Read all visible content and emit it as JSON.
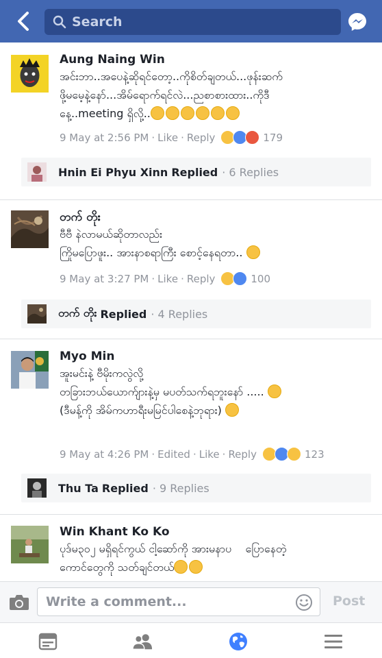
{
  "header": {
    "search_placeholder": "Search"
  },
  "comments": [
    {
      "author": "Aung Naing Win",
      "lines": [
        "အင်းဘာ..အပေနဲ့ဆိုရင်တော့..ကိုစိတ်ချတယ်...ဖုန်းဆက်",
        "ဖို့မမေ့နဲ့နော်...အိမ်ရောက်ရင်လဲ...ညစာစားထား..ကိုဒီ",
        "နေ့..meeting ရှိလို့.."
      ],
      "emoji_trail": [
        "grin",
        "grin",
        "joy",
        "joy",
        "joy",
        "joy"
      ],
      "time": "9 May at 2:56 PM",
      "edited": "",
      "like": "Like",
      "reply": "Reply",
      "reactions": [
        "haha",
        "like",
        "angry"
      ],
      "reaction_count": "179",
      "reply_preview": {
        "name": "Hnin Ei Phyu Xinn",
        "label": "Replied",
        "count": "6 Replies"
      }
    },
    {
      "author": "တက် တိုး",
      "lines": [
        "ဗီဗီ နဲလာမယ်ဆိုတာလည်း",
        "ကြိုမပြောဖူး.. အားနာစရာကြီး စောင့်နေရတာ.."
      ],
      "emoji_trail": [
        "joy"
      ],
      "time": "9 May at 3:27 PM",
      "edited": "",
      "like": "Like",
      "reply": "Reply",
      "reactions": [
        "haha",
        "like"
      ],
      "reaction_count": "100",
      "reply_preview": {
        "name": "တက် တိုး",
        "label": "Replied",
        "count": "4 Replies"
      }
    },
    {
      "author": "Myo Min",
      "lines": [
        "အူးမင်းနဲ့ ဗီမိုးကလွဲလို့",
        "တခြားဘယ်ယောက်ျားနဲ့မှ မပတ်သက်ရဘူးနော် .....",
        "",
        "(ဒီမန့်ကို အိမ်ကဟာရီးမမြင်ပါစေနဲ့ဘုရား)"
      ],
      "emoji_trail": [
        "grin"
      ],
      "time": "9 May at 4:26 PM",
      "edited": "Edited",
      "like": "Like",
      "reply": "Reply",
      "reactions": [
        "haha",
        "like",
        "sad"
      ],
      "reaction_count": "123",
      "reply_preview": {
        "name": "Thu Ta",
        "label": "Replied",
        "count": "9 Replies"
      }
    },
    {
      "author": "Win Khant Ko Ko",
      "lines": [
        "ပုဒ်မ၃၀၂ မရှိရင်ကွယ် ငါ့ဆော်ကို အားမနာပ    ပြောနေတဲ့",
        "ကောင်တွေကို သတ်ချင်တယ်"
      ],
      "emoji_trail": [
        "cool",
        "cool"
      ],
      "time": "",
      "edited": "",
      "like": "",
      "reply": "",
      "reactions": [],
      "reaction_count": ""
    }
  ],
  "composer": {
    "placeholder": "Write a comment...",
    "post_label": "Post"
  },
  "bottom_nav": [
    "news-feed-icon",
    "friends-icon",
    "globe-notifications-icon",
    "menu-icon"
  ],
  "colors": {
    "brand": "#4267b2",
    "search_bg": "#2c4a8c",
    "meta": "#90949c",
    "like_blue": "#4f88f0",
    "haha_yellow": "#f7c242",
    "angry_red": "#e9573f"
  }
}
